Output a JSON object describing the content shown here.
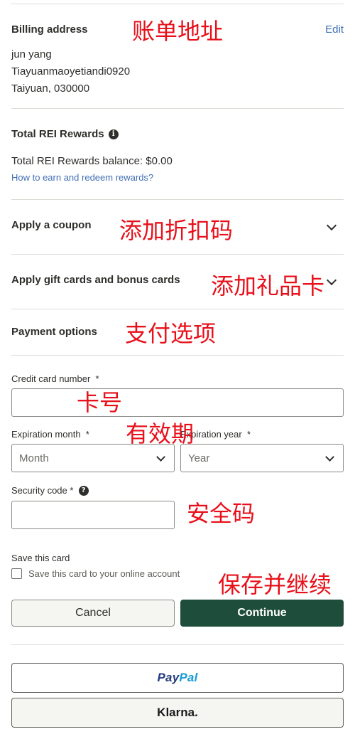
{
  "billing": {
    "title": "Billing address",
    "edit": "Edit",
    "name": "jun yang",
    "street": "Tiayuanmaoyetiandi0920",
    "city": "Taiyuan, 030000",
    "annotation": "账单地址"
  },
  "rewards": {
    "title": "Total REI Rewards",
    "info_icon": "i",
    "balance": "Total REI Rewards balance: $0.00",
    "link": "How to earn and redeem rewards?"
  },
  "coupon": {
    "title": "Apply a coupon",
    "annotation": "添加折扣码"
  },
  "gift_cards": {
    "title": "Apply gift cards and bonus cards",
    "annotation": "添加礼品卡"
  },
  "payment": {
    "title": "Payment options",
    "annotation": "支付选项",
    "card_number_label": "Credit card number",
    "card_number_annotation": "卡号",
    "expiry_annotation": "有效期",
    "exp_month_label": "Expiration month",
    "exp_month_value": "Month",
    "exp_year_label": "Expiration year",
    "exp_year_value": "Year",
    "security_label": "Security code",
    "security_help_icon": "?",
    "security_annotation": "安全码",
    "required_mark": "*",
    "save_title": "Save this card",
    "save_checkbox_label": "Save this card to your online account",
    "save_annotation": "保存并继续"
  },
  "actions": {
    "cancel": "Cancel",
    "continue": "Continue"
  },
  "wallets": {
    "paypal_a": "Pay",
    "paypal_b": "Pal",
    "klarna": "Klarna."
  },
  "colors": {
    "link": "#406eb5",
    "annotation": "#e8101a",
    "continue_bg": "#1e4d3b"
  }
}
